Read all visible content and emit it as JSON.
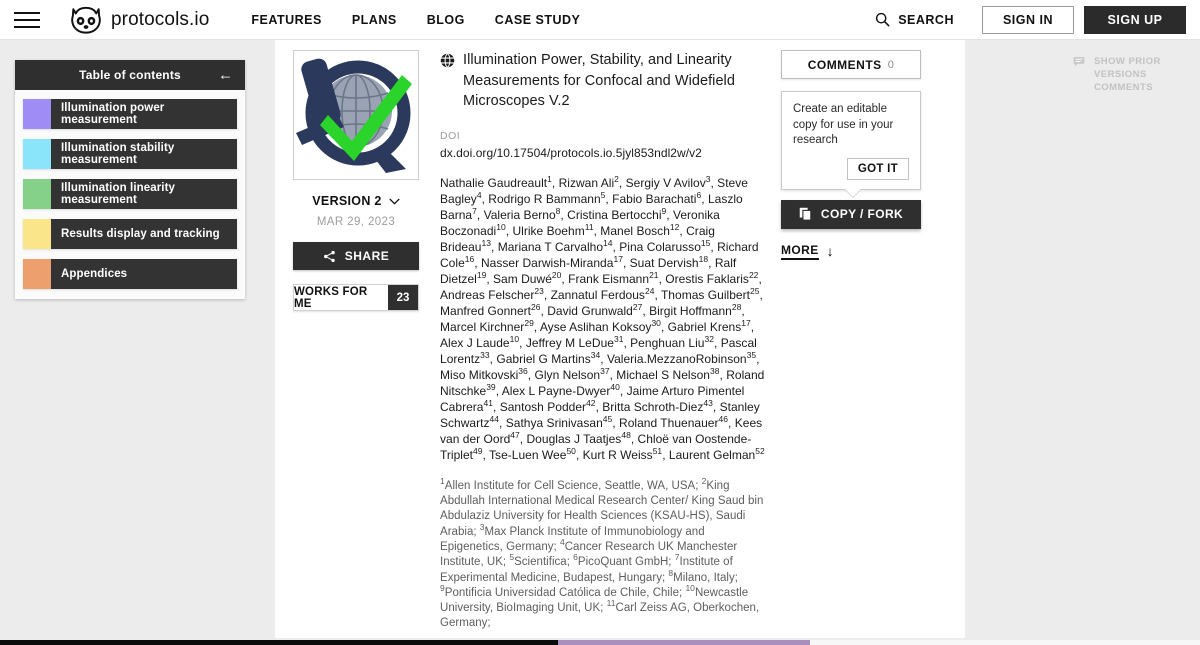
{
  "header": {
    "logo_text": "protocols.io",
    "nav": [
      {
        "label": "FEATURES"
      },
      {
        "label": "PLANS"
      },
      {
        "label": "BLOG"
      },
      {
        "label": "CASE STUDY"
      }
    ],
    "search_label": "SEARCH",
    "sign_in_label": "SIGN IN",
    "sign_up_label": "SIGN UP"
  },
  "toc": {
    "title": "Table of contents",
    "collapse_icon": "←",
    "items": [
      {
        "label": "Illumination power measurement",
        "color": "#9f8cf5"
      },
      {
        "label": "Illumination stability measurement",
        "color": "#8ae4fa"
      },
      {
        "label": "Illumination linearity measurement",
        "color": "#85d18a"
      },
      {
        "label": "Results display and tracking",
        "color": "#fae58a"
      },
      {
        "label": "Appendices",
        "color": "#eda06e"
      }
    ]
  },
  "protocol_column": {
    "version_label": "VERSION 2",
    "version_date": "MAR 29, 2023",
    "share_label": "SHARE",
    "works_for_me_label": "WORKS FOR ME",
    "works_for_me_count": "23"
  },
  "article": {
    "title": "Illumination Power, Stability, and Linearity Measurements for Confocal and Widefield Microscopes V.2",
    "doi_label": "DOI",
    "doi_value": "dx.doi.org/10.17504/protocols.io.5jyl853ndl2w/v2",
    "authors_html": "Nathalie Gaudreault<sup>1</sup>, Rizwan Ali<sup>2</sup>, Sergiy V Avilov<sup>3</sup>, Steve Bagley<sup>4</sup>, Rodrigo R Bammann<sup>5</sup>, Fabio Barachati<sup>6</sup>, Laszlo Barna<sup>7</sup>, Valeria Berno<sup>8</sup>, Cristina Bertocchi<sup>9</sup>, Veronika Boczonadi<sup>10</sup>, Ulrike Boehm<sup>11</sup>, Manel Bosch<sup>12</sup>, Craig Brideau<sup>13</sup>, Mariana T Carvalho<sup>14</sup>, Pina Colarusso<sup>15</sup>, Richard Cole<sup>16</sup>, Nasser Darwish-Miranda<sup>17</sup>, Suat Dervish<sup>18</sup>, Ralf Dietzel<sup>19</sup>, Sam Duwé<sup>20</sup>, Frank Eismann<sup>21</sup>, Orestis Faklaris<sup>22</sup>, Andreas Felscher<sup>23</sup>, Zannatul Ferdous<sup>24</sup>, Thomas Guilbert<sup>25</sup>, Manfred Gonnert<sup>26</sup>, David Grunwald<sup>27</sup>, Birgit Hoffmann<sup>28</sup>, Marcel Kirchner<sup>29</sup>, Ayse Aslihan Koksoy<sup>30</sup>, Gabriel Krens<sup>17</sup>, Alex J Laude<sup>10</sup>, Jeffrey M LeDue<sup>31</sup>, Penghuan Liu<sup>32</sup>, Pascal Lorentz<sup>33</sup>, Gabriel G Martins<sup>34</sup>, Valeria.MezzanoRobinson<sup>35</sup>, Miso Mitkovski<sup>36</sup>, Glyn Nelson<sup>37</sup>, Michael S Nelson<sup>38</sup>, Roland Nitschke<sup>39</sup>, Alex L Payne-Dwyer<sup>40</sup>, Jaime Arturo Pimentel Cabrera<sup>41</sup>, Santosh Podder<sup>42</sup>, Britta Schroth-Diez<sup>43</sup>, Stanley Schwartz<sup>44</sup>, Sathya Srinivasan<sup>45</sup>, Roland Thuenauer<sup>46</sup>, Kees van der Oord<sup>47</sup>, Douglas J Taatjes<sup>48</sup>, Chloë van Oostende-Triplet<sup>49</sup>, Tse-Luen Wee<sup>50</sup>, Kurt R Weiss<sup>51</sup>, Laurent Gelman<sup>52</sup>",
    "affiliations_html": "<sup>1</sup>Allen Institute for Cell Science, Seattle, WA, USA; <sup>2</sup>King Abdullah International Medical Research Center/ King Saud bin Abdulaziz University for Health Sciences (KSAU-HS), Saudi Arabia; <sup>3</sup>Max Planck Institute of Immunobiology and Epigenetics, Germany; <sup>4</sup>Cancer Research UK Manchester Institute, UK; <sup>5</sup>Scientifica; <sup>6</sup>PicoQuant GmbH; <sup>7</sup>Institute of Experimental Medicine, Budapest, Hungary; <sup>8</sup>Milano, Italy; <sup>9</sup>Pontificia Universidad Católica de Chile, Chile; <sup>10</sup>Newcastle University, BioImaging Unit, UK; <sup>11</sup>Carl Zeiss AG, Oberkochen, Germany;"
  },
  "rail": {
    "comments_label": "COMMENTS",
    "comments_count": "0",
    "tooltip_text": "Create an editable copy for use in your research",
    "tooltip_button": "GOT IT",
    "fork_label": "COPY / FORK",
    "more_label": "MORE",
    "more_icon": "↓"
  },
  "prior_versions": {
    "line1": "SHOW PRIOR",
    "line2": "VERSIONS COMMENTS"
  }
}
